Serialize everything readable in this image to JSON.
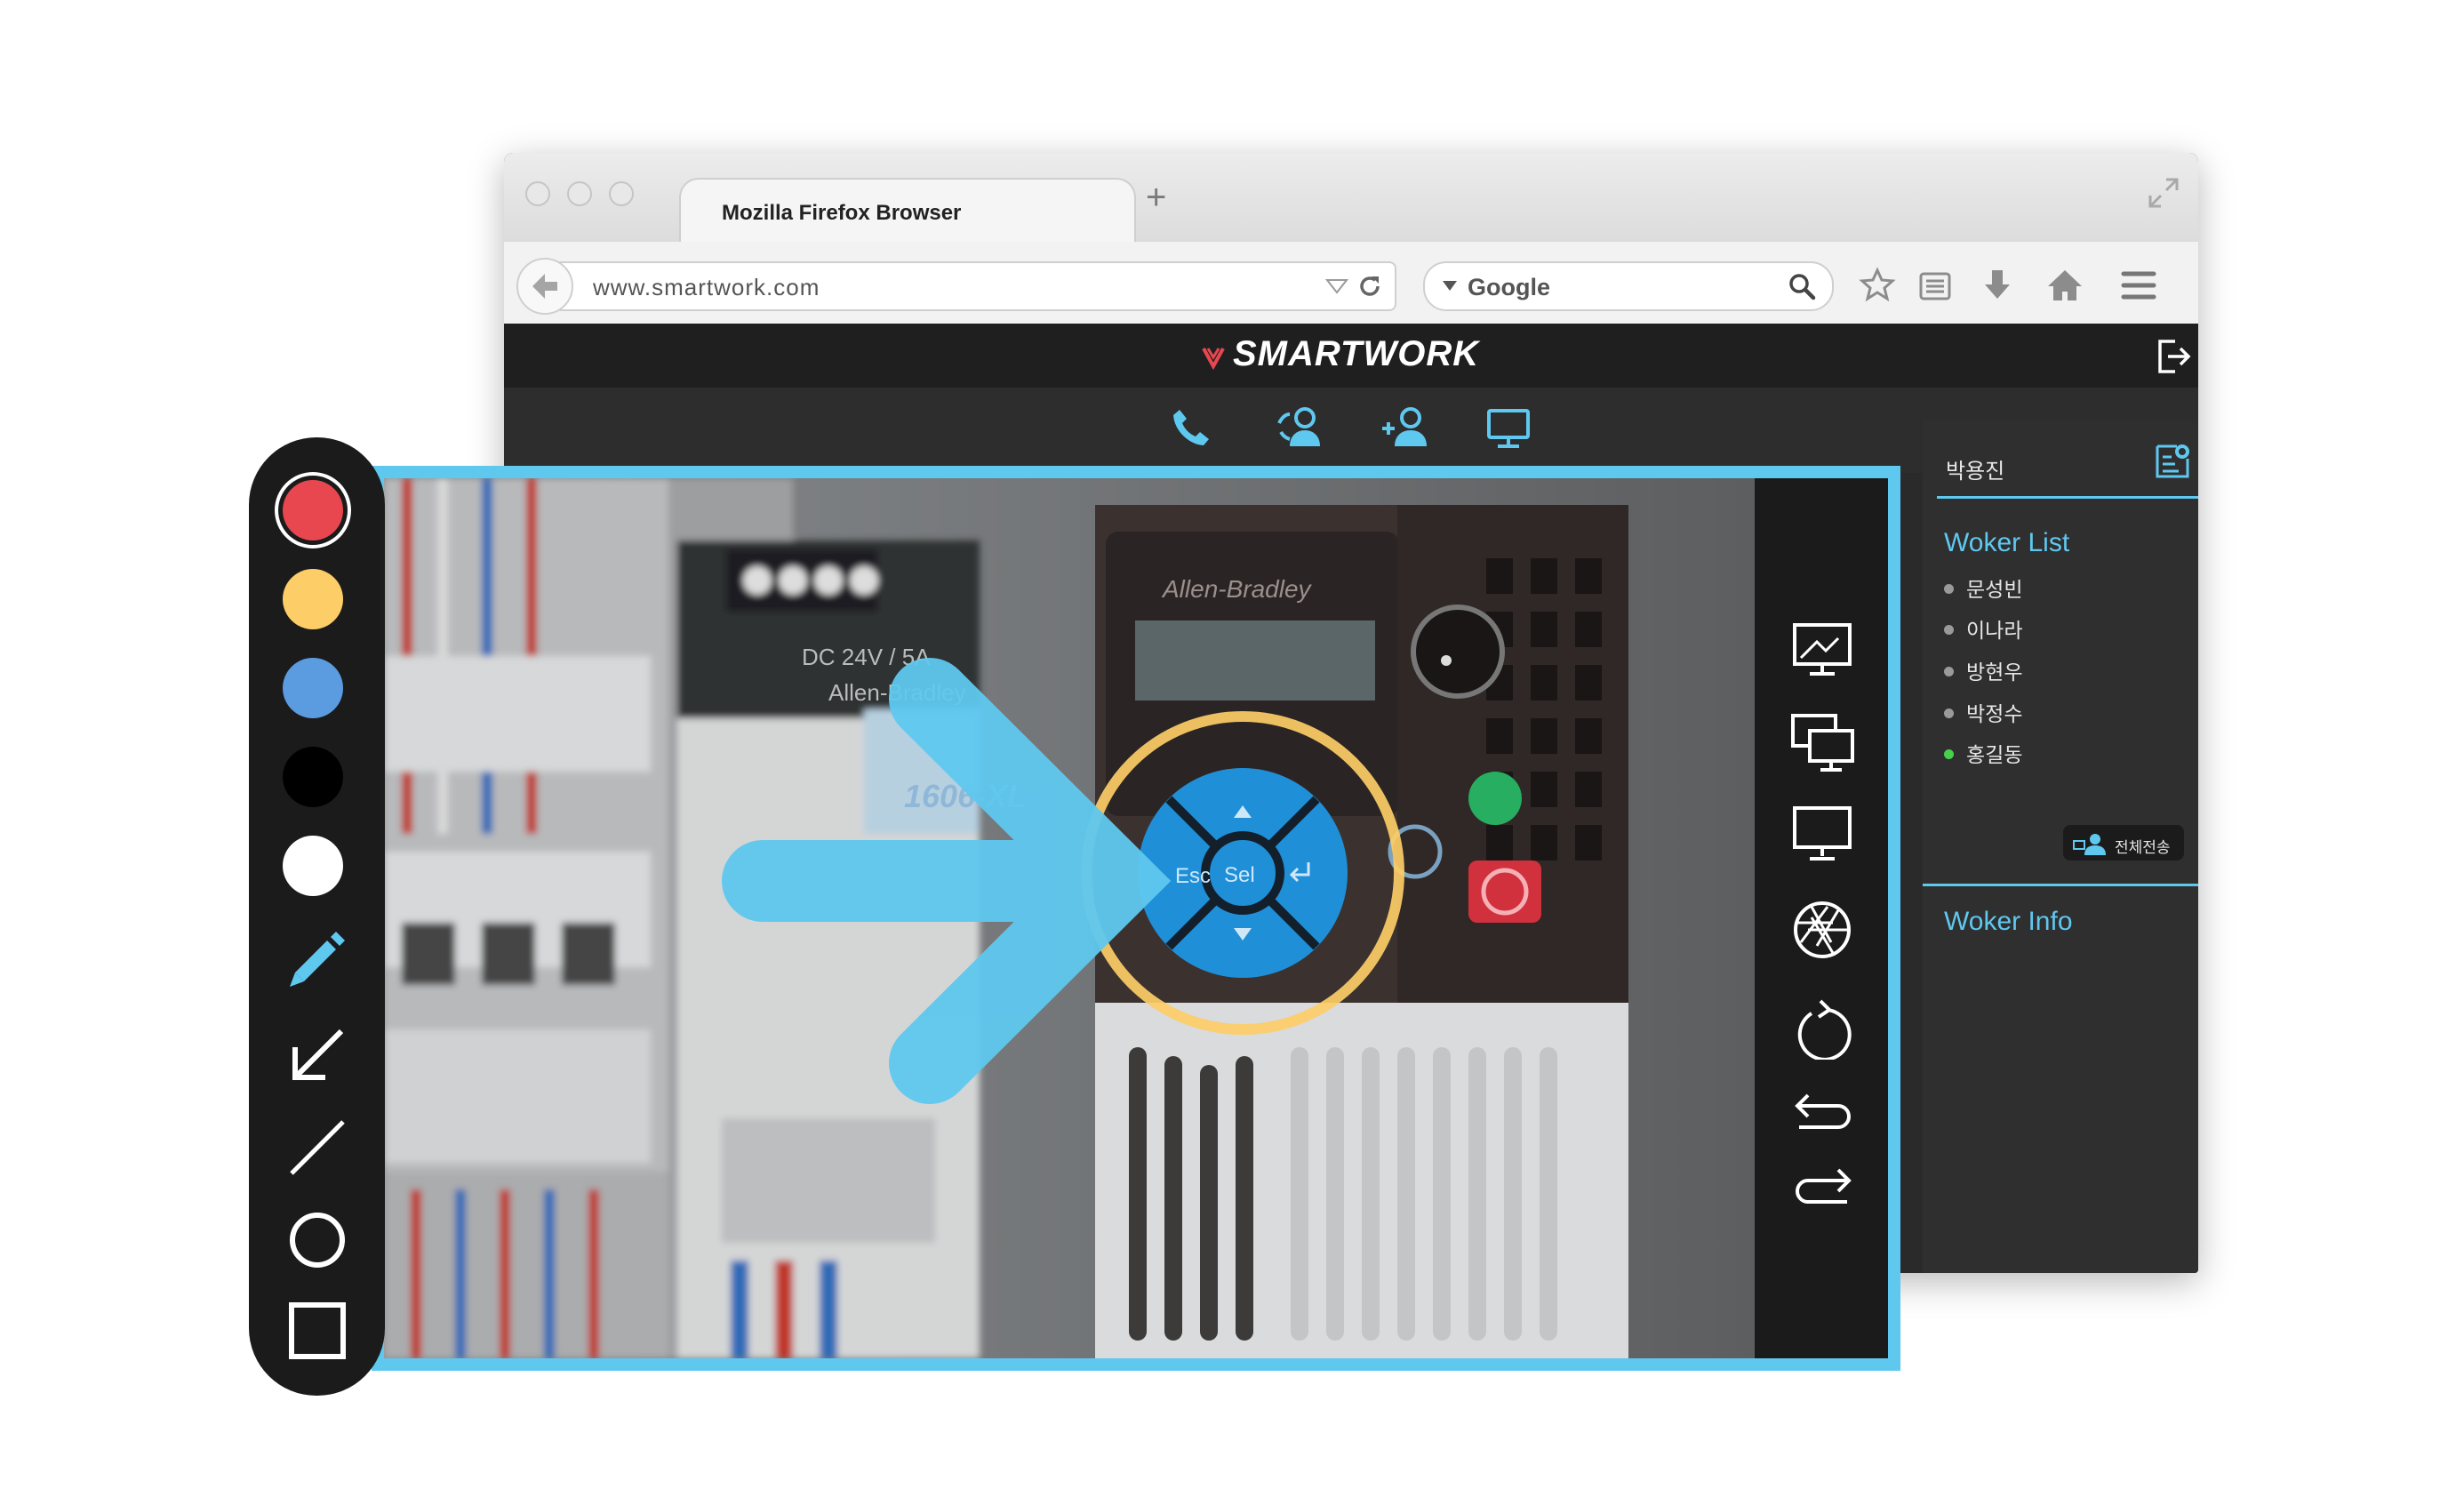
{
  "browser": {
    "tab_title": "Mozilla Firefox Browser",
    "new_tab_symbol": "+",
    "url": "www.smartwork.com",
    "search_engine": "Google"
  },
  "app": {
    "brand": "SMARTWORK",
    "accent_color": "#5fc8ef",
    "nav_icons": [
      "phone-icon",
      "group-call-icon",
      "add-user-icon",
      "monitor-icon"
    ]
  },
  "sidebar": {
    "user_name": "박용진",
    "worker_list_title": "Woker List",
    "workers": [
      {
        "name": "문성빈",
        "online": false
      },
      {
        "name": "이나라",
        "online": false
      },
      {
        "name": "방현우",
        "online": false
      },
      {
        "name": "박정수",
        "online": false
      },
      {
        "name": "홍길동",
        "online": true
      }
    ],
    "broadcast_button": "전체전송",
    "worker_info_title": "Woker Info"
  },
  "video_panel": {
    "device_brand": "Allen-Bradley",
    "psu_label": "DC 24V / 5A",
    "psu_model": "1606-XL",
    "keypad": {
      "esc": "Esc",
      "sel": "Sel"
    },
    "tools": [
      "screen-share-icon",
      "dual-screen-icon",
      "monitor-icon",
      "aperture-icon",
      "refresh-icon",
      "undo-icon",
      "redo-icon"
    ]
  },
  "drawing_toolbar": {
    "colors": [
      "#e8474f",
      "#fdcd67",
      "#5b9be0",
      "#000000",
      "#ffffff"
    ],
    "tools": [
      "marker-icon",
      "arrow-icon",
      "line-icon",
      "circle-icon",
      "rectangle-icon"
    ]
  }
}
